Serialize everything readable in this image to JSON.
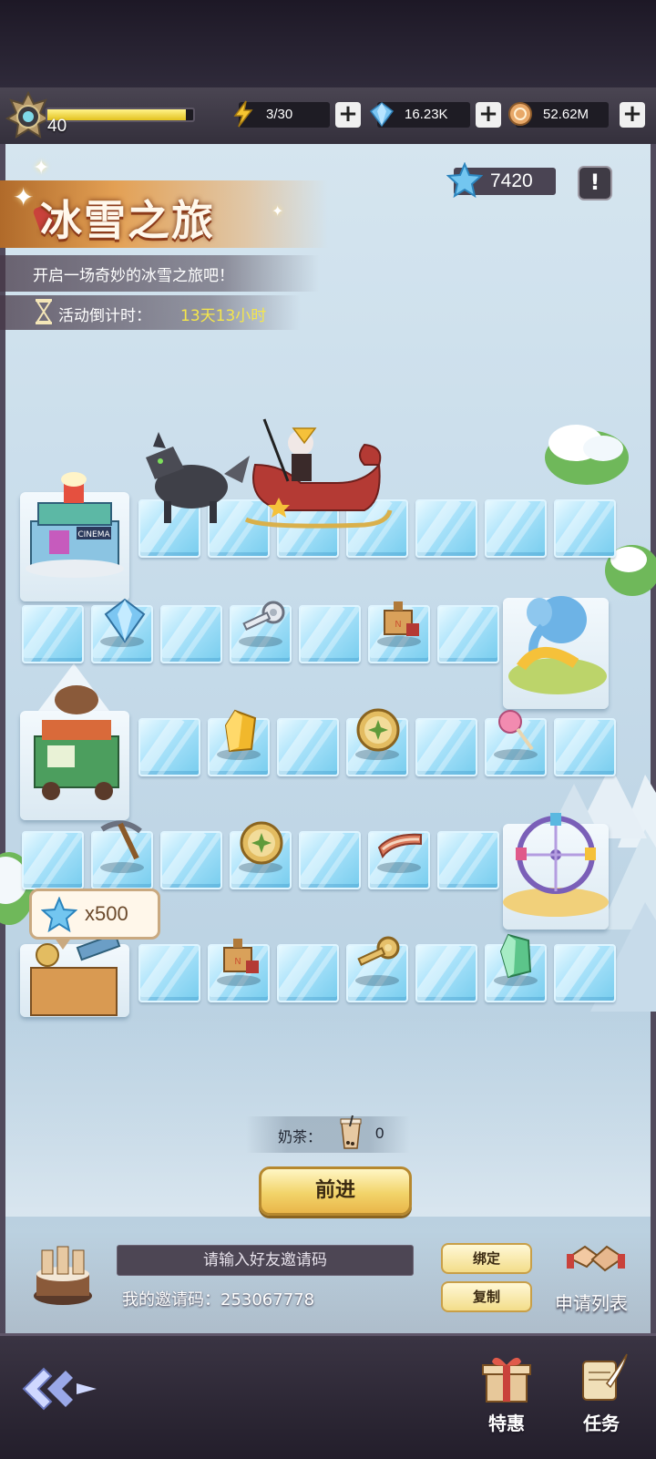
{
  "header": {
    "level": "40",
    "xp_fraction": 0.95,
    "energy": "3/30",
    "diamonds": "16.23K",
    "coins": "52.62M"
  },
  "event": {
    "title": "冰雪之旅",
    "subtitle": "开启一场奇妙的冰雪之旅吧！",
    "countdown_label": "活动倒计时：",
    "countdown_value": "13天13小时",
    "star_points": "7420",
    "info_symbol": "!"
  },
  "board": {
    "reward_bubble": "x500",
    "items": [
      "diamond-icon",
      "key-icon",
      "toolbox-icon",
      "gold-crystal-icon",
      "clover-coin-icon",
      "lollipop-icon",
      "pickaxe-icon",
      "clover-coin-icon",
      "bacon-icon",
      "toolbox-icon",
      "key-icon",
      "green-crystal-icon"
    ],
    "buildings": [
      "cinema",
      "elephant-park",
      "teahouse-cart",
      "ferris-wheel",
      "observatory"
    ]
  },
  "milk_tea": {
    "label": "奶茶：",
    "count": "0"
  },
  "advance_button": "前进",
  "invite": {
    "placeholder": "请输入好友邀请码",
    "my_code": "我的邀请码：253067778",
    "bind_button": "绑定",
    "copy_button": "复制",
    "apply_list": "申请列表"
  },
  "bottom_nav": {
    "deals": "特惠",
    "tasks": "任务"
  },
  "colors": {
    "accent_gold": "#f2d46a",
    "countdown": "#f5e64b",
    "ice": "#aee4fb"
  }
}
